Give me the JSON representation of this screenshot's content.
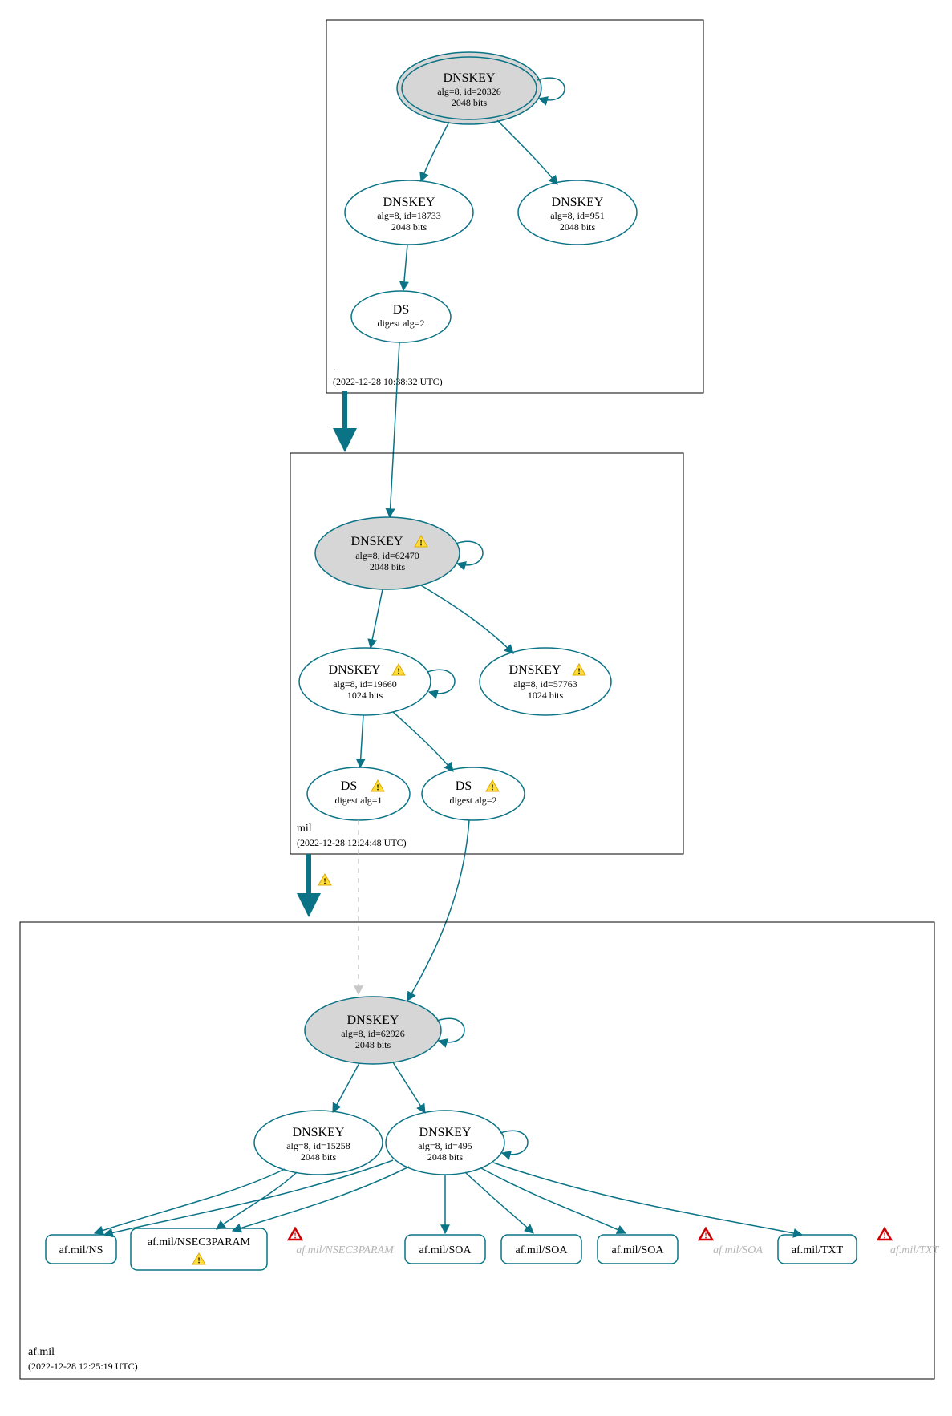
{
  "zones": {
    "root": {
      "name": ".",
      "timestamp": "(2022-12-28 10:38:32 UTC)"
    },
    "mil": {
      "name": "mil",
      "timestamp": "(2022-12-28 12:24:48 UTC)"
    },
    "afmil": {
      "name": "af.mil",
      "timestamp": "(2022-12-28 12:25:19 UTC)"
    }
  },
  "nodes": {
    "root_ksk": {
      "title": "DNSKEY",
      "l2": "alg=8, id=20326",
      "l3": "2048 bits"
    },
    "root_zsk1": {
      "title": "DNSKEY",
      "l2": "alg=8, id=18733",
      "l3": "2048 bits"
    },
    "root_zsk2": {
      "title": "DNSKEY",
      "l2": "alg=8, id=951",
      "l3": "2048 bits"
    },
    "root_ds": {
      "title": "DS",
      "l2": "digest alg=2"
    },
    "mil_ksk": {
      "title": "DNSKEY",
      "l2": "alg=8, id=62470",
      "l3": "2048 bits"
    },
    "mil_zsk1": {
      "title": "DNSKEY",
      "l2": "alg=8, id=19660",
      "l3": "1024 bits"
    },
    "mil_zsk2": {
      "title": "DNSKEY",
      "l2": "alg=8, id=57763",
      "l3": "1024 bits"
    },
    "mil_ds1": {
      "title": "DS",
      "l2": "digest alg=1"
    },
    "mil_ds2": {
      "title": "DS",
      "l2": "digest alg=2"
    },
    "af_ksk": {
      "title": "DNSKEY",
      "l2": "alg=8, id=62926",
      "l3": "2048 bits"
    },
    "af_zsk1": {
      "title": "DNSKEY",
      "l2": "alg=8, id=15258",
      "l3": "2048 bits"
    },
    "af_zsk2": {
      "title": "DNSKEY",
      "l2": "alg=8, id=495",
      "l3": "2048 bits"
    }
  },
  "rr": {
    "ns": "af.mil/NS",
    "n3p": "af.mil/NSEC3PARAM",
    "n3p_f": "af.mil/NSEC3PARAM",
    "soa1": "af.mil/SOA",
    "soa2": "af.mil/SOA",
    "soa3": "af.mil/SOA",
    "soa_f": "af.mil/SOA",
    "txt": "af.mil/TXT",
    "txt_f": "af.mil/TXT"
  }
}
